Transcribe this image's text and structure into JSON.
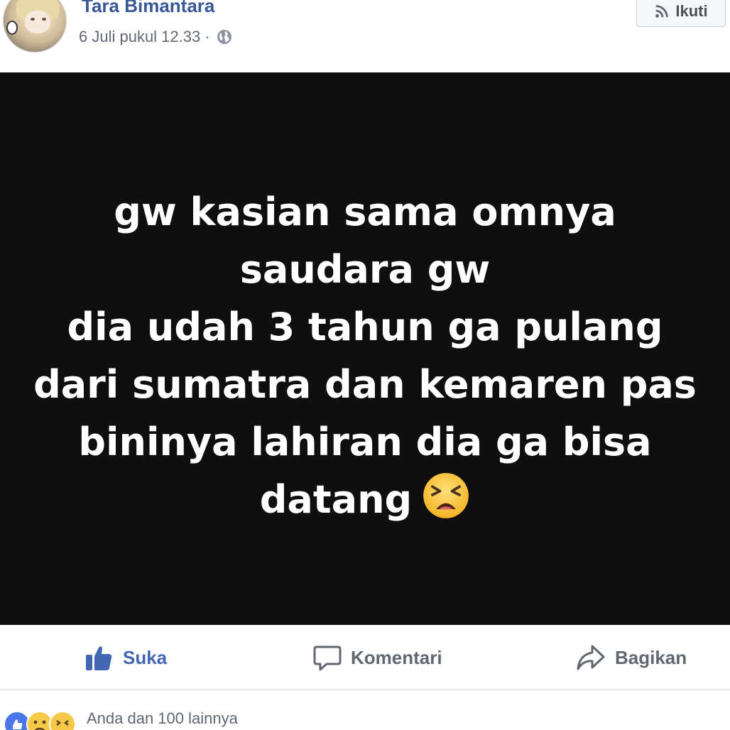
{
  "post": {
    "author": "Tara Bimantara",
    "timestamp": "6 Juli pukul 12.33",
    "separator": "·",
    "privacy_icon": "globe-icon",
    "follow_label": "Ikuti",
    "follow_icon": "rss-icon"
  },
  "image_text": {
    "lines": [
      "gw kasian sama omnya",
      "saudara gw",
      "dia udah 3 tahun ga pulang",
      "dari sumatra dan kemaren pas",
      "bininya lahiran dia ga bisa",
      "datang"
    ],
    "emoji": "tired-face-emoji",
    "background": "#0f0f0f",
    "text_color": "#ffffff"
  },
  "actions": {
    "like_label": "Suka",
    "comment_label": "Komentari",
    "share_label": "Bagikan",
    "like_color": "#4267b2",
    "text_color": "#606770"
  },
  "reactions": {
    "icons": [
      "like-reaction-icon",
      "sad-reaction-icon",
      "haha-reaction-icon"
    ],
    "summary": "Anda dan 100 lainnya"
  },
  "colors": {
    "author_name": "#385898",
    "meta_text": "#616770"
  }
}
